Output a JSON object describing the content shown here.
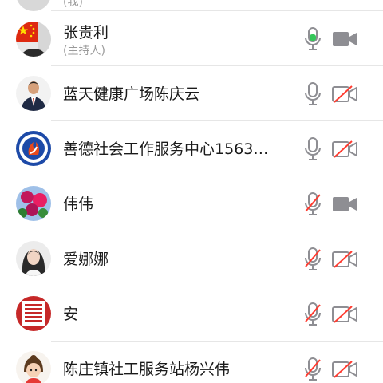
{
  "participants_above": {
    "role": "(我)"
  },
  "participants": [
    {
      "name": "张贵利",
      "role": "(主持人)",
      "mic": "active",
      "camera": "on"
    },
    {
      "name": "蓝天健康广场陈庆云",
      "role": "",
      "mic": "on",
      "camera": "off"
    },
    {
      "name": "善德社会工作服务中心1563…",
      "role": "",
      "mic": "on",
      "camera": "off"
    },
    {
      "name": "伟伟",
      "role": "",
      "mic": "muted",
      "camera": "on"
    },
    {
      "name": "爱娜娜",
      "role": "",
      "mic": "muted",
      "camera": "off"
    },
    {
      "name": "安",
      "role": "",
      "mic": "muted",
      "camera": "off"
    },
    {
      "name": "陈庄镇社工服务站杨兴伟",
      "role": "",
      "mic": "muted",
      "camera": "off"
    }
  ],
  "icons": {
    "mic": "microphone-icon",
    "mic_muted": "microphone-muted-icon",
    "camera": "video-camera-icon",
    "camera_off": "video-camera-off-icon"
  },
  "colors": {
    "icon_gray": "#8e8e93",
    "mute_red": "#ff3b30",
    "speaking_green": "#34c759",
    "divider": "#e6e6e6"
  }
}
